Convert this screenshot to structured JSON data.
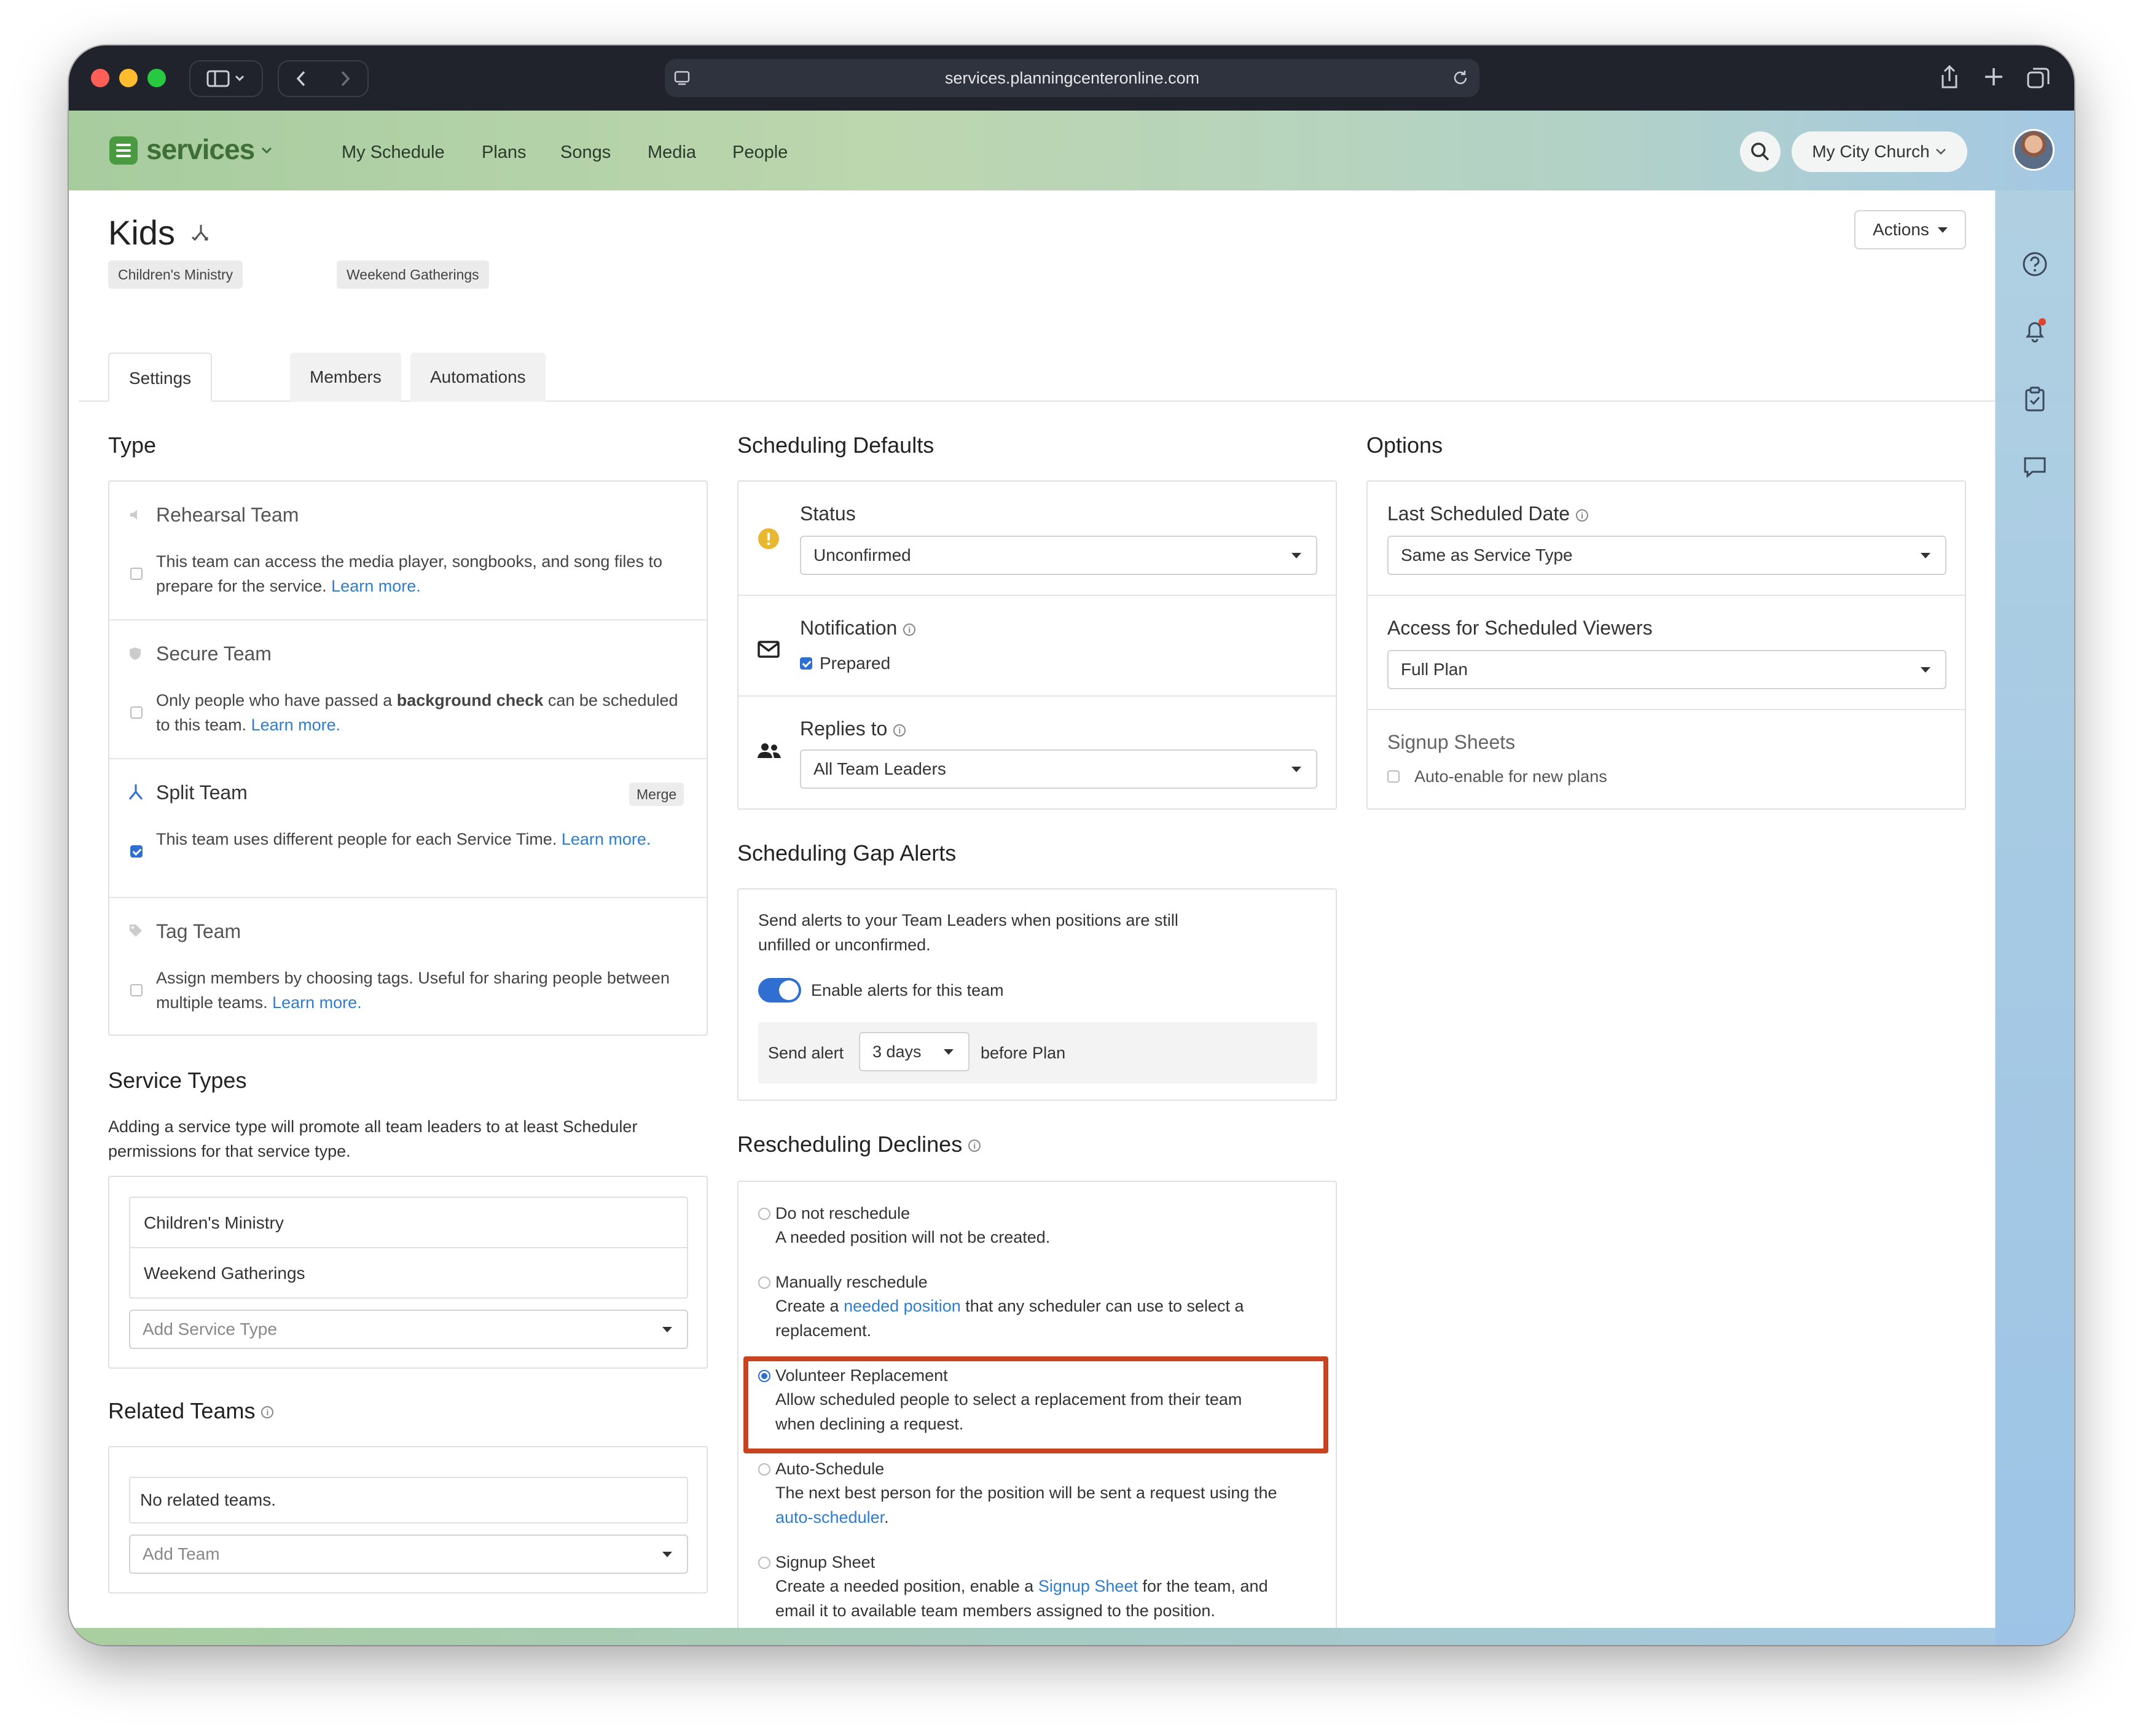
{
  "browser": {
    "url": "services.planningcenteronline.com"
  },
  "appbar": {
    "logo": "services",
    "nav": [
      "My Schedule",
      "Plans",
      "Songs",
      "Media",
      "People"
    ],
    "org": "My City Church"
  },
  "header": {
    "title": "Kids",
    "tags": [
      "Children's Ministry",
      "Weekend Gatherings"
    ],
    "actions": "Actions",
    "tabs": [
      "Settings",
      "Members",
      "Automations"
    ]
  },
  "type_section": {
    "heading": "Type",
    "items": [
      {
        "title": "Rehearsal Team",
        "desc": "This team can access the media player, songbooks, and song files to prepare for the service.",
        "link": "Learn more."
      },
      {
        "title": "Secure Team",
        "desc_pre": "Only people who have passed a ",
        "desc_bold": "background check",
        "desc_post": " can be scheduled to this team.",
        "link": "Learn more."
      },
      {
        "title": "Split Team",
        "badge": "Merge",
        "desc": "This team uses different people for each Service Time.",
        "link": "Learn more."
      },
      {
        "title": "Tag Team",
        "desc": "Assign members by choosing tags. Useful for sharing people between multiple teams.",
        "link": "Learn more."
      }
    ]
  },
  "service_types": {
    "heading": "Service Types",
    "desc": "Adding a service type will promote all team leaders to at least Scheduler permissions for that service type.",
    "items": [
      "Children's Ministry",
      "Weekend Gatherings"
    ],
    "add_placeholder": "Add Service Type"
  },
  "related_teams": {
    "heading": "Related Teams",
    "empty": "No related teams.",
    "add_placeholder": "Add Team"
  },
  "scheduling_defaults": {
    "heading": "Scheduling Defaults",
    "status_label": "Status",
    "status_value": "Unconfirmed",
    "notification_label": "Notification",
    "notification_check": "Prepared",
    "replies_label": "Replies to",
    "replies_value": "All Team Leaders"
  },
  "gap_alerts": {
    "heading": "Scheduling Gap Alerts",
    "desc": "Send alerts to your Team Leaders when positions are still unfilled or unconfirmed.",
    "toggle_label": "Enable alerts for this team",
    "send_alert": "Send alert",
    "days": "3 days",
    "before": "before Plan"
  },
  "rescheduling": {
    "heading": "Rescheduling Declines",
    "options": [
      {
        "title": "Do not reschedule",
        "desc": "A needed position will not be created."
      },
      {
        "title": "Manually reschedule",
        "desc_pre": "Create a ",
        "desc_link": "needed position",
        "desc_post": " that any scheduler can use to select a replacement."
      },
      {
        "title": "Volunteer Replacement",
        "desc": "Allow scheduled people to select a replacement from their team when declining a request."
      },
      {
        "title": "Auto-Schedule",
        "desc_pre": "The next best person for the position will be sent a request using the ",
        "desc_link": "auto-scheduler",
        "desc_post": "."
      },
      {
        "title": "Signup Sheet",
        "desc_pre": "Create a needed position, enable a ",
        "desc_link": "Signup Sheet",
        "desc_post": " for the team, and email it to available team members assigned to the position."
      }
    ]
  },
  "options": {
    "heading": "Options",
    "last_date_label": "Last Scheduled Date",
    "last_date_value": "Same as Service Type",
    "access_label": "Access for Scheduled Viewers",
    "access_value": "Full Plan",
    "signup_label": "Signup Sheets",
    "signup_check": "Auto-enable for new plans"
  },
  "colors": {
    "accent": "#2e6fd1",
    "brand": "#4a9a42",
    "highlight": "#c8431f",
    "status_warning": "#e8b830"
  }
}
